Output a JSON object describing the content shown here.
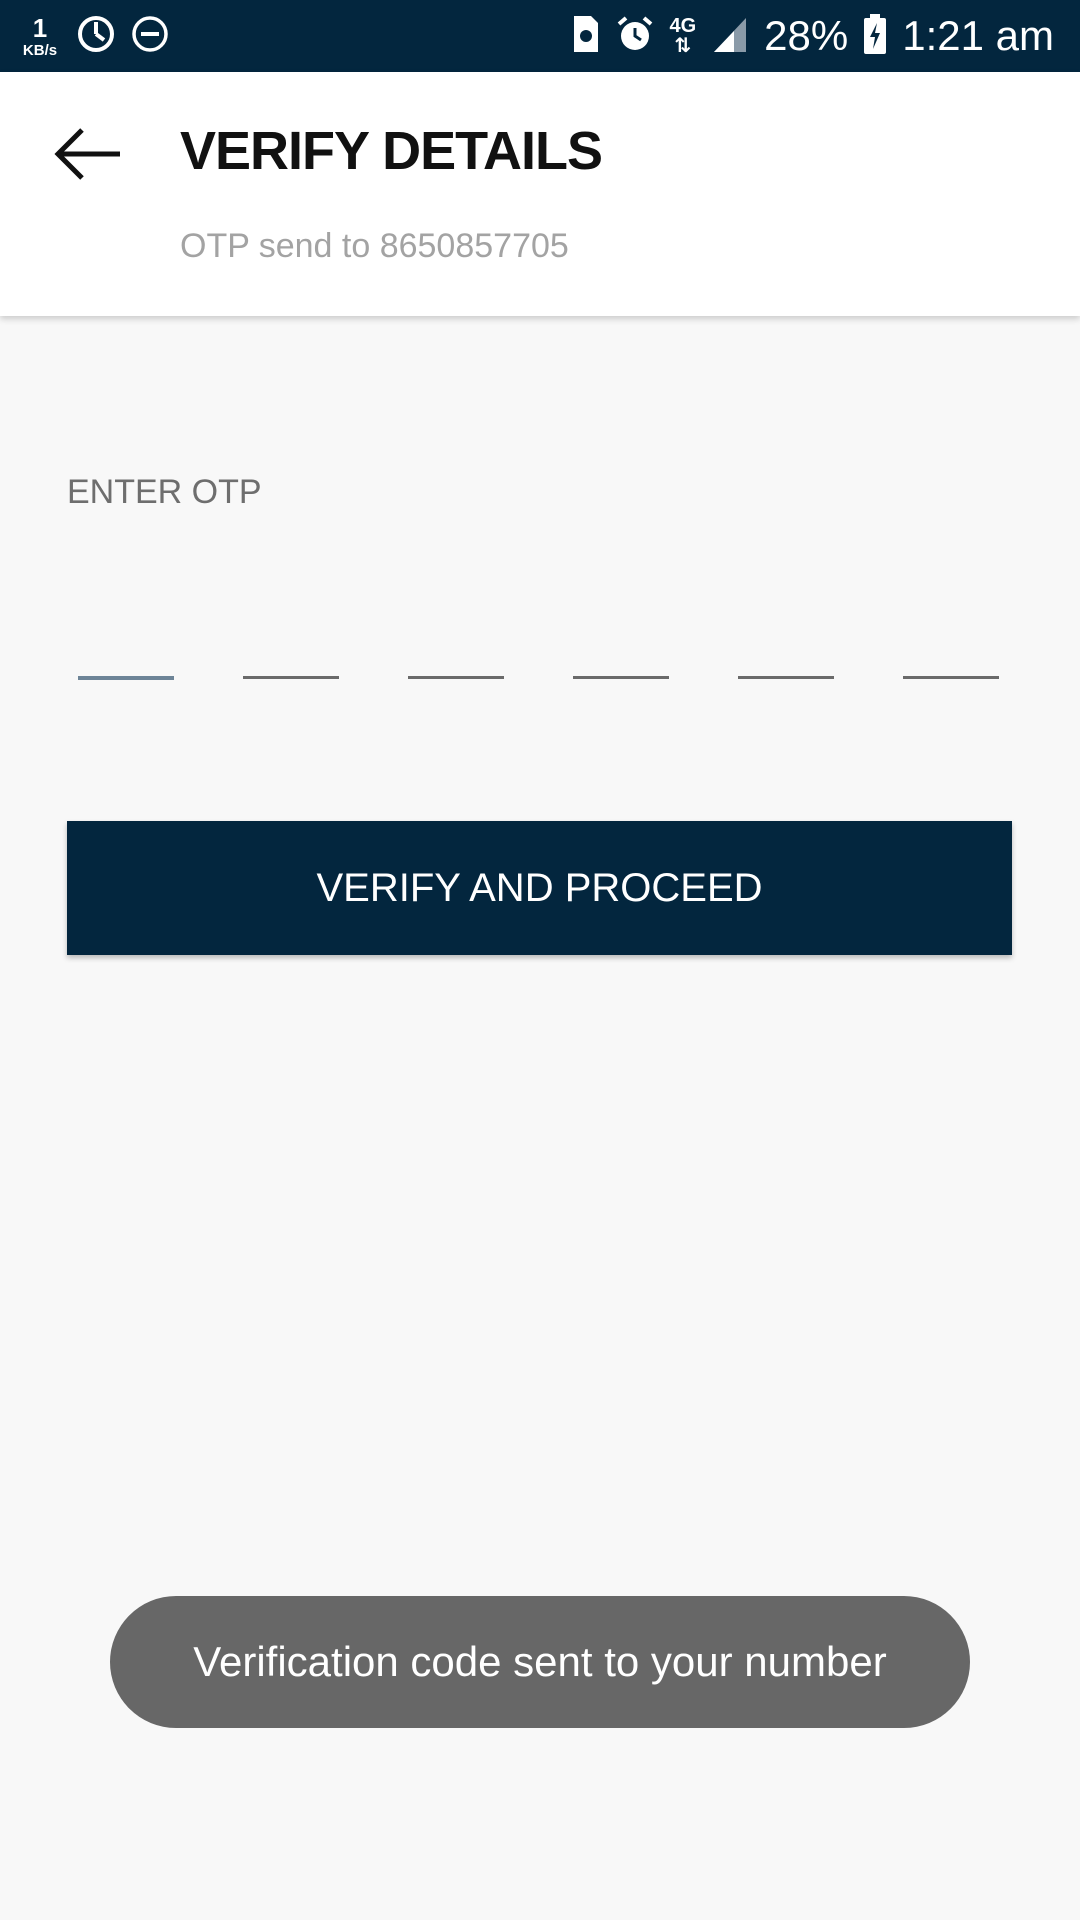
{
  "status_bar": {
    "net_speed_value": "1",
    "net_speed_unit": "KB/s",
    "network_type": "4G",
    "battery_percent": "28%",
    "time": "1:21 am",
    "icons": [
      "sync-icon",
      "do-not-disturb-icon",
      "sim-icon",
      "alarm-icon",
      "signal-icon",
      "battery-charging-icon"
    ]
  },
  "header": {
    "back_icon": "arrow-left-icon",
    "title": "VERIFY DETAILS",
    "subtitle": "OTP send to 8650857705"
  },
  "otp": {
    "label": "ENTER OTP",
    "digits": [
      "",
      "",
      "",
      "",
      "",
      ""
    ]
  },
  "actions": {
    "verify_label": "VERIFY AND PROCEED"
  },
  "toast": {
    "message": "Verification code sent to your number"
  },
  "colors": {
    "primary": "#03263e",
    "background": "#f8f8f8",
    "toast_bg": "#676767",
    "subtitle": "#a3a3a3",
    "active_underline": "#6d8497"
  }
}
